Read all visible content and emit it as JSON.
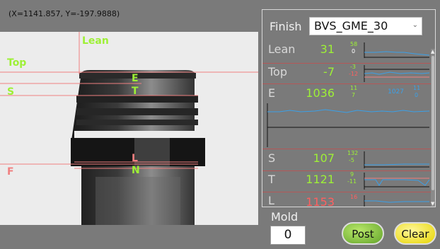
{
  "coordinates": "(X=1141.857, Y=-197.9888)",
  "image_labels": {
    "lean": "Lean",
    "top": "Top",
    "s": "S",
    "f": "F",
    "e": "E",
    "t": "T",
    "l": "L",
    "n": "N"
  },
  "panel": {
    "finish_label": "Finish",
    "finish_value": "BVS_GME_30",
    "rows": [
      {
        "name": "Lean",
        "value": "31",
        "hi": "58",
        "lo": "0",
        "value_color": "#9ef036",
        "hi_color": "#9ef036",
        "lo_color": "#ffffff"
      },
      {
        "name": "Top",
        "value": "-7",
        "hi": "-3",
        "lo": "-12",
        "value_color": "#9ef036",
        "hi_color": "#9ef036",
        "lo_color": "#ff6060"
      },
      {
        "name": "E",
        "value": "1036",
        "hi": "11",
        "lo": "7",
        "value_color": "#9ef036",
        "hi_color": "#9ef036",
        "lo_color": "#9ef036",
        "extra_value": "1027",
        "extra_hi": "11",
        "extra_lo": "0"
      },
      {
        "name": "S",
        "value": "107",
        "hi": "132",
        "lo": "-5",
        "value_color": "#9ef036",
        "hi_color": "#9ef036",
        "lo_color": "#9ef036"
      },
      {
        "name": "T",
        "value": "1121",
        "hi": "9",
        "lo": "-11",
        "value_color": "#9ef036",
        "hi_color": "#9ef036",
        "lo_color": "#9ef036"
      },
      {
        "name": "L",
        "value": "1153",
        "hi": "16",
        "lo": "",
        "value_color": "#ff6060",
        "hi_color": "#ff6060",
        "lo_color": "#ff6060"
      }
    ]
  },
  "mold": {
    "label": "Mold",
    "value": "0"
  },
  "buttons": {
    "post": "Post",
    "clear": "Clear"
  },
  "colors": {
    "green": "#9ef036",
    "red": "#ff6060",
    "line": "#f08080",
    "blue": "#3aa0e8"
  }
}
